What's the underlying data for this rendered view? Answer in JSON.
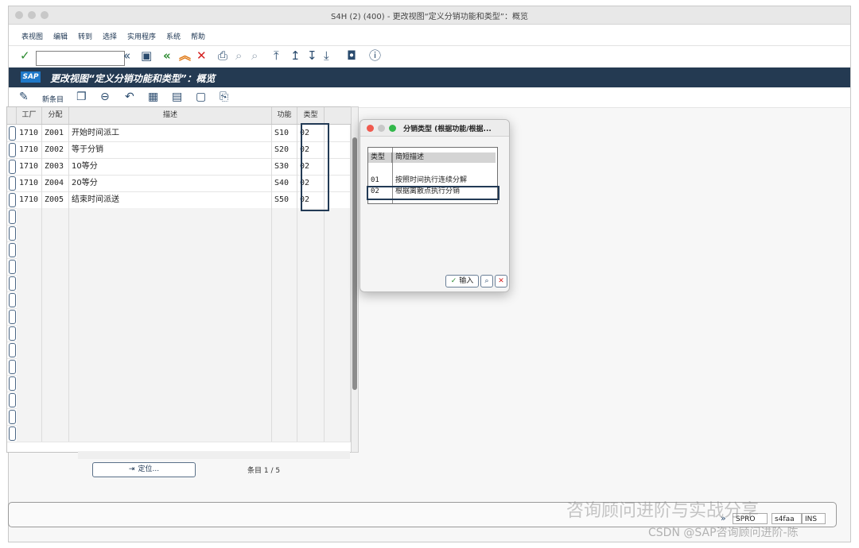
{
  "window": {
    "title": "S4H (2) (400) - 更改视图“定义分销功能和类型”：概览"
  },
  "menu": [
    "表视图",
    "编辑",
    "转到",
    "选择",
    "实用程序",
    "系统",
    "帮助"
  ],
  "toolbar": {
    "command_value": ""
  },
  "header": {
    "logo": "SAP",
    "title": "更改视图“定义分销功能和类型”：概览"
  },
  "app_toolbar": {
    "new_entries": "新条目"
  },
  "grid": {
    "columns": [
      "工厂",
      "分配",
      "描述",
      "功能",
      "类型"
    ],
    "rows": [
      {
        "plant": "1710",
        "assign": "Z001",
        "desc": "开始时间派工",
        "func": "S10",
        "type": "02"
      },
      {
        "plant": "1710",
        "assign": "Z002",
        "desc": "等于分销",
        "func": "S20",
        "type": "02"
      },
      {
        "plant": "1710",
        "assign": "Z003",
        "desc": "10等分",
        "func": "S30",
        "type": "02"
      },
      {
        "plant": "1710",
        "assign": "Z004",
        "desc": "20等分",
        "func": "S40",
        "type": "02"
      },
      {
        "plant": "1710",
        "assign": "Z005",
        "desc": "结束时间派送",
        "func": "S50",
        "type": "02"
      }
    ]
  },
  "position_button": "定位...",
  "entry_count": "条目 1 / 5",
  "popup": {
    "title": "分销类型 (根据功能/根据...",
    "columns": [
      "类型",
      "简短描述"
    ],
    "rows": [
      {
        "type": "01",
        "desc": "按照时间执行连续分解"
      },
      {
        "type": "02",
        "desc": "根据离散点执行分销"
      }
    ],
    "enter_label": "输入"
  },
  "status": {
    "tcode": "SPRO",
    "server": "s4faa",
    "mode": "INS"
  },
  "watermark": {
    "main": "咨询顾问进阶与实战分享",
    "csdn": "CSDN @SAP咨询顾问进阶-陈"
  }
}
